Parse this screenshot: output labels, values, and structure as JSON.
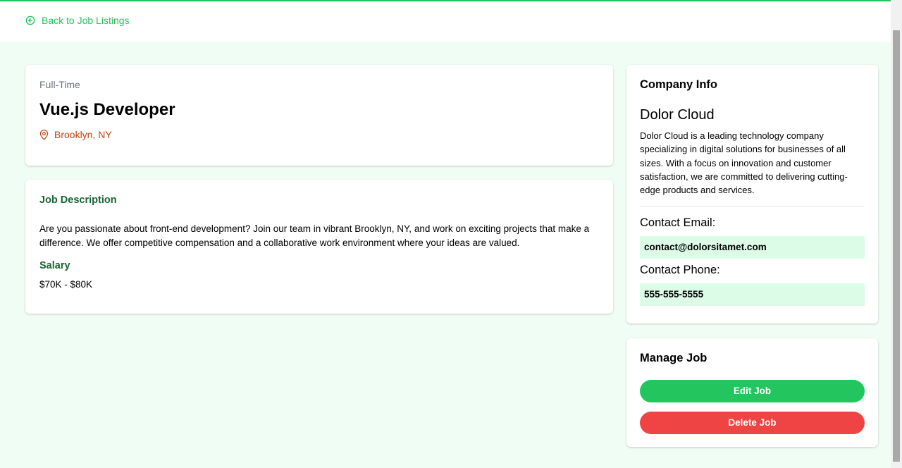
{
  "nav": {
    "back_label": "Back to Job Listings",
    "back_icon": "arrow-circle-left-icon"
  },
  "job": {
    "type": "Full-Time",
    "title": "Vue.js Developer",
    "location": "Brooklyn, NY",
    "location_icon": "map-pin-icon",
    "description_heading": "Job Description",
    "description": "Are you passionate about front-end development? Join our team in vibrant Brooklyn, NY, and work on exciting projects that make a difference. We offer competitive compensation and a collaborative work environment where your ideas are valued.",
    "salary_heading": "Salary",
    "salary": "$70K - $80K"
  },
  "company": {
    "panel_title": "Company Info",
    "name": "Dolor Cloud",
    "description": "Dolor Cloud is a leading technology company specializing in digital solutions for businesses of all sizes. With a focus on innovation and customer satisfaction, we are committed to delivering cutting-edge products and services.",
    "email_label": "Contact Email:",
    "email": "contact@dolorsitamet.com",
    "phone_label": "Contact Phone:",
    "phone": "555-555-5555"
  },
  "manage": {
    "panel_title": "Manage Job",
    "edit_label": "Edit Job",
    "delete_label": "Delete Job"
  },
  "colors": {
    "accent": "#22c55e",
    "background": "#f0fdf4",
    "heading_green": "#166534",
    "location": "#c2410c",
    "danger": "#ef4444",
    "contact_bg": "#dcfce7"
  }
}
